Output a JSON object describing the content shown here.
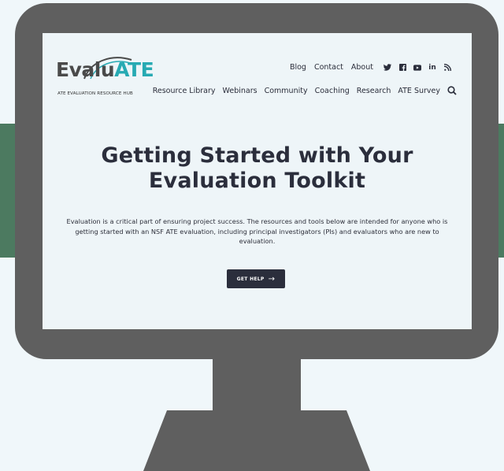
{
  "colors": {
    "background": "#f0f7fa",
    "band": "#4c7a60",
    "monitor": "#5f5f5f",
    "screen": "#eef5f8",
    "accent": "#27aab3",
    "dark": "#2b2e3c"
  },
  "logo": {
    "word_part1": "Evalu",
    "word_part2": "ATE",
    "tagline": "ATE EVALUATION RESOURCE HUB"
  },
  "top_nav": {
    "links": [
      "Blog",
      "Contact",
      "About"
    ],
    "social_icons": [
      "twitter-icon",
      "facebook-icon",
      "youtube-icon",
      "linkedin-icon",
      "rss-icon"
    ],
    "linkedin_label": "in"
  },
  "main_nav": {
    "links": [
      "Resource Library",
      "Webinars",
      "Community",
      "Coaching",
      "Research",
      "ATE Survey"
    ],
    "search_icon": "search-icon"
  },
  "hero": {
    "title_line1": "Getting Started with Your",
    "title_line2": "Evaluation Toolkit",
    "description": "Evaluation is a critical part of ensuring project success. The resources and tools below are intended for anyone who is getting started with an NSF ATE evaluation, including principal investigators (PIs) and evaluators who are new to evaluation.",
    "cta_label": "GET HELP",
    "cta_icon": "arrow-right-icon"
  }
}
